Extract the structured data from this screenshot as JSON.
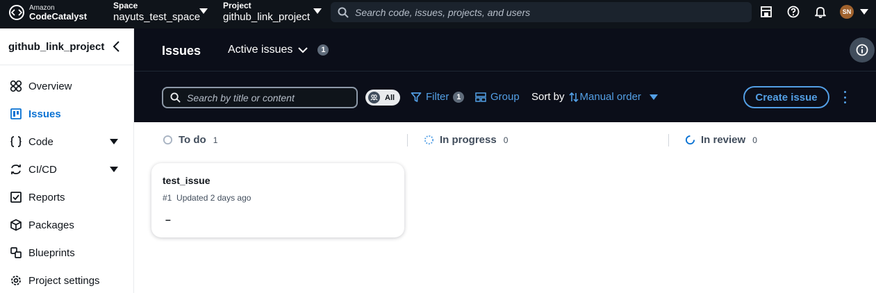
{
  "topnav": {
    "logo_small": "Amazon",
    "logo_big": "CodeCatalyst",
    "space_label": "Space",
    "space_value": "nayuts_test_space",
    "project_label": "Project",
    "project_value": "github_link_project",
    "search_placeholder": "Search code, issues, projects, and users",
    "icons": [
      "calendar-icon",
      "help-icon",
      "notifications-icon"
    ],
    "avatar_initials": "SN"
  },
  "sidebar": {
    "project_name": "github_link_project",
    "items": [
      {
        "label": "Overview",
        "icon": "overview-icon",
        "active": false,
        "expandable": false
      },
      {
        "label": "Issues",
        "icon": "issues-icon",
        "active": true,
        "expandable": false
      },
      {
        "label": "Code",
        "icon": "code-icon",
        "active": false,
        "expandable": true
      },
      {
        "label": "CI/CD",
        "icon": "cicd-icon",
        "active": false,
        "expandable": true
      },
      {
        "label": "Reports",
        "icon": "reports-icon",
        "active": false,
        "expandable": false
      },
      {
        "label": "Packages",
        "icon": "packages-icon",
        "active": false,
        "expandable": false
      },
      {
        "label": "Blueprints",
        "icon": "blueprints-icon",
        "active": false,
        "expandable": false
      },
      {
        "label": "Project settings",
        "icon": "settings-icon",
        "active": false,
        "expandable": false
      }
    ]
  },
  "header": {
    "title": "Issues",
    "view": "Active issues",
    "view_count": "1",
    "search_placeholder": "Search by title or content",
    "assignee_toggle": "All",
    "filter_label": "Filter",
    "filter_count": "1",
    "group_label": "Group",
    "sort_label": "Sort by",
    "sort_value": "Manual order",
    "create_label": "Create issue"
  },
  "board": {
    "columns": [
      {
        "name": "To do",
        "count": "1"
      },
      {
        "name": "In progress",
        "count": "0"
      },
      {
        "name": "In review",
        "count": "0"
      }
    ],
    "cards": [
      {
        "title": "test_issue",
        "number": "#1",
        "updated": "Updated 2 days ago",
        "assignee": "–"
      }
    ]
  },
  "colors": {
    "nav_bg": "#0f141a",
    "header_bg": "#0b0e19",
    "accent": "#539fe5",
    "active_link": "#0972d3"
  }
}
